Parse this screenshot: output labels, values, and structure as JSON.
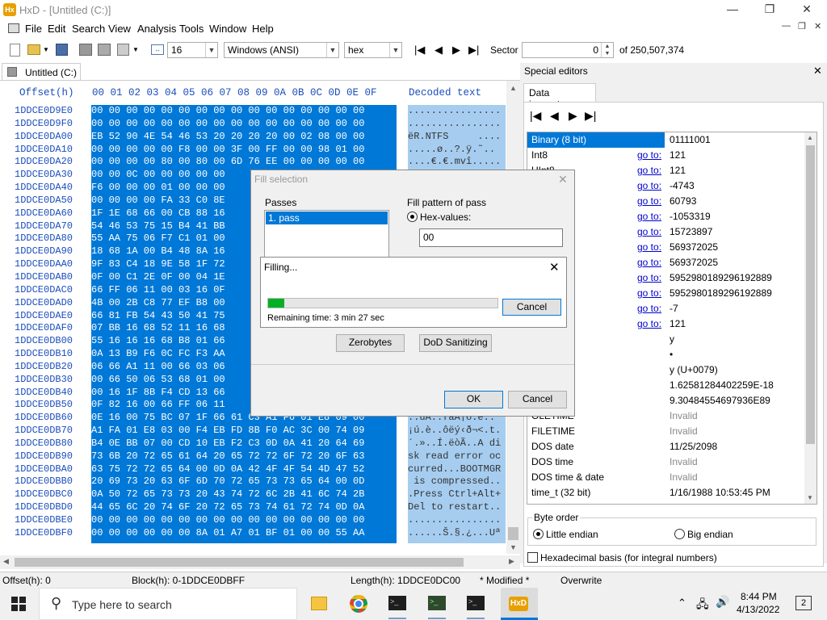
{
  "window": {
    "title": "HxD - [Untitled (C:)]"
  },
  "menu": [
    "File",
    "Edit",
    "Search",
    "View",
    "Analysis",
    "Tools",
    "Window",
    "Help"
  ],
  "toolbar": {
    "bytes_per_row": "16",
    "charset": "Windows (ANSI)",
    "mode": "hex",
    "sector_label": "Sector",
    "sector_value": "0",
    "sector_total": "of 250,507,374"
  },
  "doc_tab": "Untitled (C:)",
  "hex_header": {
    "offset": "Offset(h)",
    "cols": "00 01 02 03 04 05 06 07 08 09 0A 0B 0C 0D 0E 0F",
    "decoded": "Decoded text"
  },
  "offsets": [
    "1DDCE0D9E0",
    "1DDCE0D9F0",
    "1DDCE0DA00",
    "1DDCE0DA10",
    "1DDCE0DA20",
    "1DDCE0DA30",
    "1DDCE0DA40",
    "1DDCE0DA50",
    "1DDCE0DA60",
    "1DDCE0DA70",
    "1DDCE0DA80",
    "1DDCE0DA90",
    "1DDCE0DAA0",
    "1DDCE0DAB0",
    "1DDCE0DAC0",
    "1DDCE0DAD0",
    "1DDCE0DAE0",
    "1DDCE0DAF0",
    "1DDCE0DB00",
    "1DDCE0DB10",
    "1DDCE0DB20",
    "1DDCE0DB30",
    "1DDCE0DB40",
    "1DDCE0DB50",
    "1DDCE0DB60",
    "1DDCE0DB70",
    "1DDCE0DB80",
    "1DDCE0DB90",
    "1DDCE0DBA0",
    "1DDCE0DBB0",
    "1DDCE0DBC0",
    "1DDCE0DBD0",
    "1DDCE0DBE0",
    "1DDCE0DBF0"
  ],
  "hex_rows": [
    "00 00 00 00 00 00 00 00 00 00 00 00 00 00 00 00",
    "00 00 00 00 00 00 00 00 00 00 00 00 00 00 00 00",
    "EB 52 90 4E 54 46 53 20 20 20 20 00 02 08 00 00",
    "00 00 00 00 00 F8 00 00 3F 00 FF 00 00 98 01 00",
    "00 00 00 00 80 00 80 00 6D 76 EE 00 00 00 00 00",
    "00 00 0C 00 00 00 00 00",
    "F6 00 00 00 01 00 00 00",
    "00 00 00 00 FA 33 C0 8E",
    "1F 1E 68 66 00 CB 88 16",
    "54 46 53 75 15 B4 41 BB",
    "55 AA 75 06 F7 C1 01 00",
    "18 68 1A 00 B4 48 8A 16",
    "9F 83 C4 18 9E 58 1F 72",
    "0F 00 C1 2E 0F 00 04 1E",
    "66 FF 06 11 00 03 16 0F",
    "4B 00 2B C8 77 EF B8 00",
    "66 81 FB 54 43 50 41 75",
    "07 BB 16 68 52 11 16 68",
    "55 16 16 16 68 B8 01 66",
    "0A 13 B9 F6 0C FC F3 AA",
    "06 66 A1 11 00 66 03 06",
    "00 66 50 06 53 68 01 00",
    "00 16 1F 8B F4 CD 13 66",
    "0F 82 16 00 66 FF 06 11",
    "0E 16 00 75 BC 07 1F 66 61 C3 A1 F6 01 E8 09 00",
    "A1 FA 01 E8 03 00 F4 EB FD 8B F0 AC 3C 00 74 09",
    "B4 0E BB 07 00 CD 10 EB F2 C3 0D 0A 41 20 64 69",
    "73 6B 20 72 65 61 64 20 65 72 72 6F 72 20 6F 63",
    "63 75 72 72 65 64 00 0D 0A 42 4F 4F 54 4D 47 52",
    "20 69 73 20 63 6F 6D 70 72 65 73 73 65 64 00 0D",
    "0A 50 72 65 73 73 20 43 74 72 6C 2B 41 6C 74 2B",
    "44 65 6C 20 74 6F 20 72 65 73 74 61 72 74 0D 0A",
    "00 00 00 00 00 00 00 00 00 00 00 00 00 00 00 00",
    "00 00 00 00 00 00 8A 01 A7 01 BF 01 00 00 55 AA"
  ],
  "decoded_rows": [
    "................",
    "................",
    "ëR.NTFS     ....",
    ".....ø..?.ÿ.˜..",
    "....€.€.mvî.....",
    "",
    "",
    "",
    "",
    "",
    "",
    "",
    "",
    "",
    "",
    "",
    "",
    "",
    "",
    "",
    "",
    "",
    "",
    "",
    "..uÀ..faÃ¡ö.è..",
    "¡ú.è..ôëý‹ð¬<.t.",
    "´.»..Í.ëòÃ..A di",
    "sk read error oc",
    "curred...BOOTMGR",
    " is compressed..",
    ".Press Ctrl+Alt+",
    "Del to restart..",
    "................",
    "......Š.§.¿...Uª"
  ],
  "special_editors": "Special editors",
  "data_inspector": "Data inspector",
  "inspector": [
    {
      "name": "Binary (8 bit)",
      "goto": "",
      "value": "01111001"
    },
    {
      "name": "Int8",
      "goto": "go to:",
      "value": "121"
    },
    {
      "name": "UInt8",
      "goto": "go to:",
      "value": "121"
    },
    {
      "name": "",
      "goto": "go to:",
      "value": "-4743"
    },
    {
      "name": "",
      "goto": "go to:",
      "value": "60793"
    },
    {
      "name": "",
      "goto": "go to:",
      "value": "-1053319"
    },
    {
      "name": "",
      "goto": "go to:",
      "value": "15723897"
    },
    {
      "name": "",
      "goto": "go to:",
      "value": "569372025"
    },
    {
      "name": "",
      "goto": "go to:",
      "value": "569372025"
    },
    {
      "name": "",
      "goto": "go to:",
      "value": "5952980189296192889"
    },
    {
      "name": "",
      "goto": "go to:",
      "value": "5952980189296192889"
    },
    {
      "name": "",
      "goto": "go to:",
      "value": "-7"
    },
    {
      "name": "",
      "goto": "go to:",
      "value": "121"
    },
    {
      "name": "/ char8_t",
      "goto": "",
      "value": "y"
    },
    {
      "name": "/ char16_t",
      "goto": "",
      "value": "•"
    },
    {
      "name": "e point",
      "goto": "",
      "value": "y (U+0079)"
    },
    {
      "name": "at32)",
      "goto": "",
      "value": "1.62581284402259E-18"
    },
    {
      "name": "oat64)",
      "goto": "",
      "value": "9.30484554697936E89"
    },
    {
      "name": "OLETIME",
      "goto": "",
      "value": "Invalid"
    },
    {
      "name": "FILETIME",
      "goto": "",
      "value": "Invalid"
    },
    {
      "name": "DOS date",
      "goto": "",
      "value": "11/25/2098"
    },
    {
      "name": "DOS time",
      "goto": "",
      "value": "Invalid"
    },
    {
      "name": "DOS time & date",
      "goto": "",
      "value": "Invalid"
    },
    {
      "name": "time_t (32 bit)",
      "goto": "",
      "value": "1/16/1988 10:53:45 PM"
    },
    {
      "name": "time_t (64 bit)",
      "goto": "",
      "value": "Invalid"
    }
  ],
  "byte_order": {
    "label": "Byte order",
    "little": "Little endian",
    "big": "Big endian"
  },
  "hex_basis": "Hexadecimal basis (for integral numbers)",
  "fill_dialog": {
    "title": "Fill selection",
    "passes_label": "Passes",
    "pass_item": "1. pass",
    "pattern_label": "Fill pattern of pass",
    "hex_values_label": "Hex-values:",
    "hex_value": "00",
    "zerobytes": "Zerobytes",
    "dod": "DoD Sanitizing",
    "ok": "OK",
    "cancel": "Cancel"
  },
  "filling": {
    "title": "Filling...",
    "remaining": "Remaining time: 3 min 27 sec",
    "cancel": "Cancel",
    "progress": 0.07
  },
  "status": {
    "offset": "Offset(h): 0",
    "block": "Block(h): 0-1DDCE0DBFF",
    "length": "Length(h): 1DDCE0DC00",
    "modified": "* Modified *",
    "overwrite": "Overwrite"
  },
  "taskbar": {
    "search": "Type here to search",
    "time": "8:44 PM",
    "date": "4/13/2022",
    "notif": "2"
  },
  "colors": {
    "selection": "#0078d7",
    "decoded_sel": "#a6cdf0",
    "offset_blue": "#1a4dbb",
    "progress": "#06b025"
  }
}
